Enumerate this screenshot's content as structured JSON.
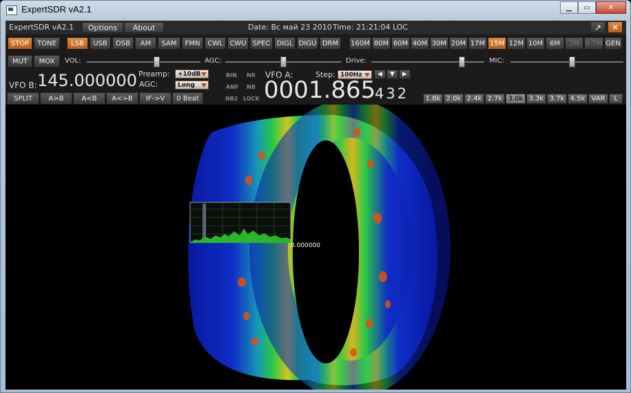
{
  "window": {
    "title": "ExpertSDR vA2.1"
  },
  "menubar": {
    "app_label": "ExpertSDR vA2.1",
    "options_label": "Options",
    "about_label": "About",
    "date_text": "Date: Вс май 23 2010",
    "time_text": "Time: 21:21:04 LOC"
  },
  "row1": {
    "stop": "STOP",
    "tone": "TONE",
    "modes": [
      "LSB",
      "USB",
      "DSB",
      "AM",
      "SAM",
      "FMN",
      "CWL",
      "CWU",
      "SPEC",
      "DIGL",
      "DIGU",
      "DRM"
    ],
    "active_mode": "LSB",
    "bands": [
      "160M",
      "80M",
      "60M",
      "40M",
      "30M",
      "20M",
      "17M",
      "15M",
      "12M",
      "10M",
      "6M",
      "2M",
      "0.7M",
      "GEN"
    ],
    "active_band": "15M",
    "dim_bands": [
      "2M",
      "0.7M"
    ]
  },
  "row2": {
    "mut": "MUT",
    "mox": "MOX",
    "vol_label": "VOL:",
    "agc_label": "AGC:",
    "drive_label": "Drive:",
    "mic_label": "MIC:",
    "vol_level": 0.62,
    "agc_level": 0.5,
    "drive_level": 0.82,
    "mic_level": 0.55
  },
  "vfo": {
    "vfo_b_label": "VFO B:",
    "vfo_b_freq": "145.000000",
    "preamp_label": "Preamp:",
    "preamp_value": "+10dB",
    "agc_label": "AGC:",
    "agc_value": "Long",
    "indicators": [
      "BIN",
      "NR",
      "ANF",
      "NB",
      "NB2",
      "LOCK"
    ],
    "vfo_a_label": "VFO A:",
    "step_label": "Step:",
    "step_value": "100Hz",
    "vfo_a_main": "0001.865",
    "vfo_a_sub": "432"
  },
  "row4": {
    "buttons": [
      "SPLIT",
      "A>B",
      "A<B",
      "A<>B",
      "IF->V",
      "0 Beat"
    ],
    "bandwidths": [
      "1.8k",
      "2.0k",
      "2.4k",
      "2.7k",
      "3.0k",
      "3.3k",
      "3.7k",
      "4.5k",
      "VAR",
      "L"
    ],
    "active_bw": "3.0k"
  },
  "display": {
    "panadapter_freq_label": "0.000000",
    "colors": {
      "low": "#0a1aa8",
      "mid": "#1ed43a",
      "high": "#e0d020",
      "peak": "#e03010",
      "accent": "#e08b3c"
    }
  }
}
